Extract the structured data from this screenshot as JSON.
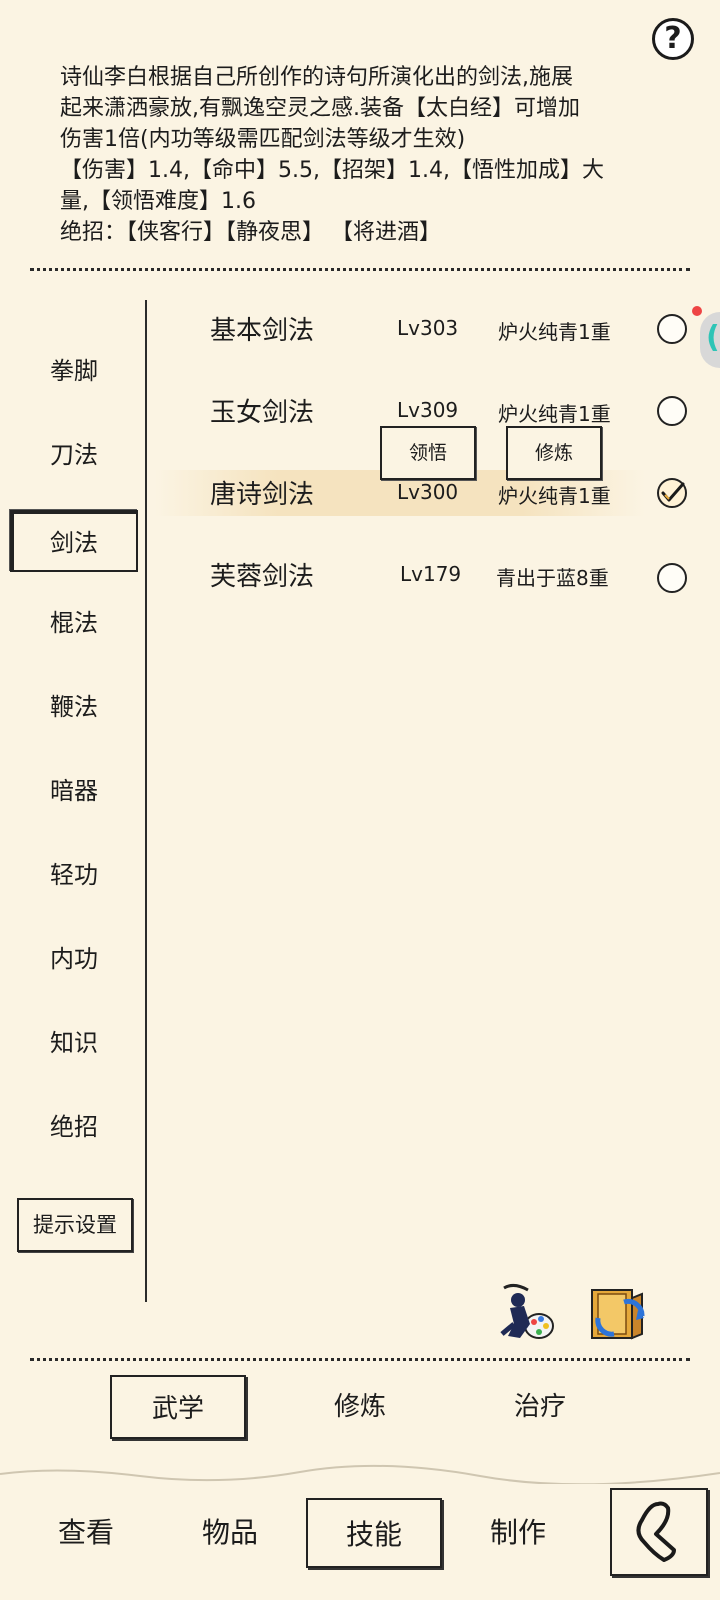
{
  "help": {
    "label": "?"
  },
  "description": {
    "line1": "诗仙李白根据自己所创作的诗句所演化出的剑法,施展",
    "line2": "起来潇洒豪放,有飘逸空灵之感.装备【太白经】可增加",
    "line3": "伤害1倍(内功等级需匹配剑法等级才生效)",
    "line4": "【伤害】1.4,【命中】5.5,【招架】1.4,【悟性加成】大",
    "line5": "量,【领悟难度】1.6",
    "line6": "绝招：【侠客行】【静夜思】 【将进酒】"
  },
  "categories": [
    {
      "label": "拳脚"
    },
    {
      "label": "刀法"
    },
    {
      "label": "剑法"
    },
    {
      "label": "棍法"
    },
    {
      "label": "鞭法"
    },
    {
      "label": "暗器"
    },
    {
      "label": "轻功"
    },
    {
      "label": "内功"
    },
    {
      "label": "知识"
    },
    {
      "label": "绝招"
    }
  ],
  "tip_settings": {
    "label": "提示设置"
  },
  "skills": [
    {
      "name": "基本剑法",
      "level": "Lv303",
      "realm": "炉火纯青1重",
      "equipped": false
    },
    {
      "name": "玉女剑法",
      "level": "Lv309",
      "realm": "炉火纯青1重",
      "equipped": false
    },
    {
      "name": "唐诗剑法",
      "level": "Lv300",
      "realm": "炉火纯青1重",
      "equipped": true
    },
    {
      "name": "芙蓉剑法",
      "level": "Lv179",
      "realm": "青出于蓝8重",
      "equipped": false
    }
  ],
  "popup_actions": {
    "comprehend": "领悟",
    "practice": "修炼"
  },
  "sub_tabs": [
    {
      "label": "武学",
      "active": true
    },
    {
      "label": "修炼",
      "active": false
    },
    {
      "label": "治疗",
      "active": false
    }
  ],
  "nav_tabs": [
    {
      "label": "查看",
      "active": false
    },
    {
      "label": "物品",
      "active": false
    },
    {
      "label": "技能",
      "active": true
    },
    {
      "label": "制作",
      "active": false
    }
  ],
  "icons": {
    "help": "question-mark-icon",
    "painter": "ninja-painter-icon",
    "exchange": "book-exchange-icon",
    "back": "back-arrow-icon"
  },
  "colors": {
    "background": "#fbf4e3",
    "highlight": "#f5e3bf",
    "check": "#e8a93a",
    "notify": "#e44444"
  }
}
